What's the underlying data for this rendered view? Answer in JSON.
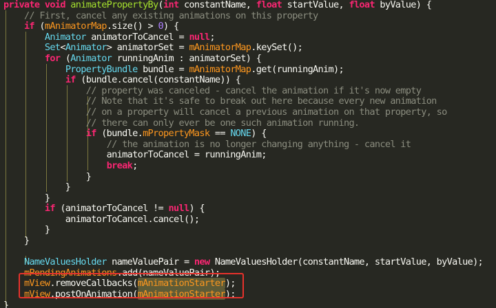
{
  "editor": {
    "language": "java",
    "theme_colors": {
      "background": "#272822",
      "keyword": "#f92672",
      "type": "#66d9ef",
      "function": "#a6e22e",
      "field": "#fd971f",
      "number": "#ae81ff",
      "comment": "#8b8d7f",
      "plain": "#f8f8f2",
      "highlight_box": "#e8322c"
    },
    "lines": [
      [
        [
          "kw",
          "private "
        ],
        [
          "kw",
          "void "
        ],
        [
          "fn",
          "animatePropertyBy"
        ],
        [
          "plain",
          "("
        ],
        [
          "kw",
          "int "
        ],
        [
          "plain",
          "constantName, "
        ],
        [
          "kw",
          "float "
        ],
        [
          "plain",
          "startValue, "
        ],
        [
          "kw",
          "float "
        ],
        [
          "plain",
          "byValue) {"
        ]
      ],
      [
        [
          "plain",
          "    "
        ],
        [
          "cmt",
          "// First, cancel any existing animations on this property"
        ]
      ],
      [
        [
          "plain",
          "    "
        ],
        [
          "kw",
          "if "
        ],
        [
          "plain",
          "("
        ],
        [
          "field",
          "mAnimatorMap"
        ],
        [
          "plain",
          ".size() > "
        ],
        [
          "num",
          "0"
        ],
        [
          "plain",
          ") {"
        ]
      ],
      [
        [
          "plain",
          "        "
        ],
        [
          "type",
          "Animator "
        ],
        [
          "plain",
          "animatorToCancel = "
        ],
        [
          "kw",
          "null"
        ],
        [
          "plain",
          ";"
        ]
      ],
      [
        [
          "plain",
          "        "
        ],
        [
          "type",
          "Set"
        ],
        [
          "plain",
          "<"
        ],
        [
          "type",
          "Animator"
        ],
        [
          "plain",
          "> animatorSet = "
        ],
        [
          "field",
          "mAnimatorMap"
        ],
        [
          "plain",
          ".keySet();"
        ]
      ],
      [
        [
          "plain",
          "        "
        ],
        [
          "kw",
          "for "
        ],
        [
          "plain",
          "("
        ],
        [
          "type",
          "Animator "
        ],
        [
          "plain",
          "runningAnim : animatorSet) {"
        ]
      ],
      [
        [
          "plain",
          "            "
        ],
        [
          "type",
          "PropertyBundle "
        ],
        [
          "plain",
          "bundle = "
        ],
        [
          "field",
          "mAnimatorMap"
        ],
        [
          "plain",
          ".get(runningAnim);"
        ]
      ],
      [
        [
          "plain",
          "            "
        ],
        [
          "kw",
          "if "
        ],
        [
          "plain",
          "(bundle.cancel(constantName)) {"
        ]
      ],
      [
        [
          "plain",
          "                "
        ],
        [
          "cmt",
          "// property was canceled - cancel the animation if it's now empty"
        ]
      ],
      [
        [
          "plain",
          "                "
        ],
        [
          "cmt",
          "// Note that it's safe to break out here because every new animation"
        ]
      ],
      [
        [
          "plain",
          "                "
        ],
        [
          "cmt",
          "// on a property will cancel a previous animation on that property, so"
        ]
      ],
      [
        [
          "plain",
          "                "
        ],
        [
          "cmt",
          "// there can only ever be one such animation running."
        ]
      ],
      [
        [
          "plain",
          "                "
        ],
        [
          "kw",
          "if "
        ],
        [
          "plain",
          "(bundle."
        ],
        [
          "field",
          "mPropertyMask"
        ],
        [
          "plain",
          " == "
        ],
        [
          "type",
          "NONE"
        ],
        [
          "plain",
          ") {"
        ]
      ],
      [
        [
          "plain",
          "                    "
        ],
        [
          "cmt",
          "// the animation is no longer changing anything - cancel it"
        ]
      ],
      [
        [
          "plain",
          "                    animatorToCancel = runningAnim;"
        ]
      ],
      [
        [
          "plain",
          "                    "
        ],
        [
          "kw",
          "break"
        ],
        [
          "plain",
          ";"
        ]
      ],
      [
        [
          "plain",
          "                }"
        ]
      ],
      [
        [
          "plain",
          "            }"
        ]
      ],
      [
        [
          "plain",
          "        }"
        ]
      ],
      [
        [
          "plain",
          "        "
        ],
        [
          "kw",
          "if "
        ],
        [
          "plain",
          "(animatorToCancel != "
        ],
        [
          "kw",
          "null"
        ],
        [
          "plain",
          ") {"
        ]
      ],
      [
        [
          "plain",
          "            animatorToCancel.cancel();"
        ]
      ],
      [
        [
          "plain",
          "        }"
        ]
      ],
      [
        [
          "plain",
          "    }"
        ]
      ],
      [
        [
          "plain",
          ""
        ]
      ],
      [
        [
          "plain",
          "    "
        ],
        [
          "type",
          "NameValuesHolder "
        ],
        [
          "plain",
          "nameValuePair = "
        ],
        [
          "kw",
          "new "
        ],
        [
          "plain",
          "NameValuesHolder(constantName, startValue, byValue);"
        ]
      ],
      [
        [
          "plain",
          "    "
        ],
        [
          "field",
          "mPendingAnimations"
        ],
        [
          "plain",
          ".add(nameValuePair);"
        ]
      ],
      [
        [
          "plain",
          "    "
        ],
        [
          "field",
          "mView"
        ],
        [
          "plain",
          ".removeCallbacks("
        ],
        [
          "hlfield",
          "mAnimationStarter"
        ],
        [
          "plain",
          ");"
        ]
      ],
      [
        [
          "plain",
          "    "
        ],
        [
          "field",
          "mView"
        ],
        [
          "plain",
          ".postOnAnimation("
        ],
        [
          "hlfield",
          "mAnimationStarter"
        ],
        [
          "plain",
          ");"
        ]
      ],
      [
        [
          "plain",
          "}"
        ]
      ]
    ]
  }
}
